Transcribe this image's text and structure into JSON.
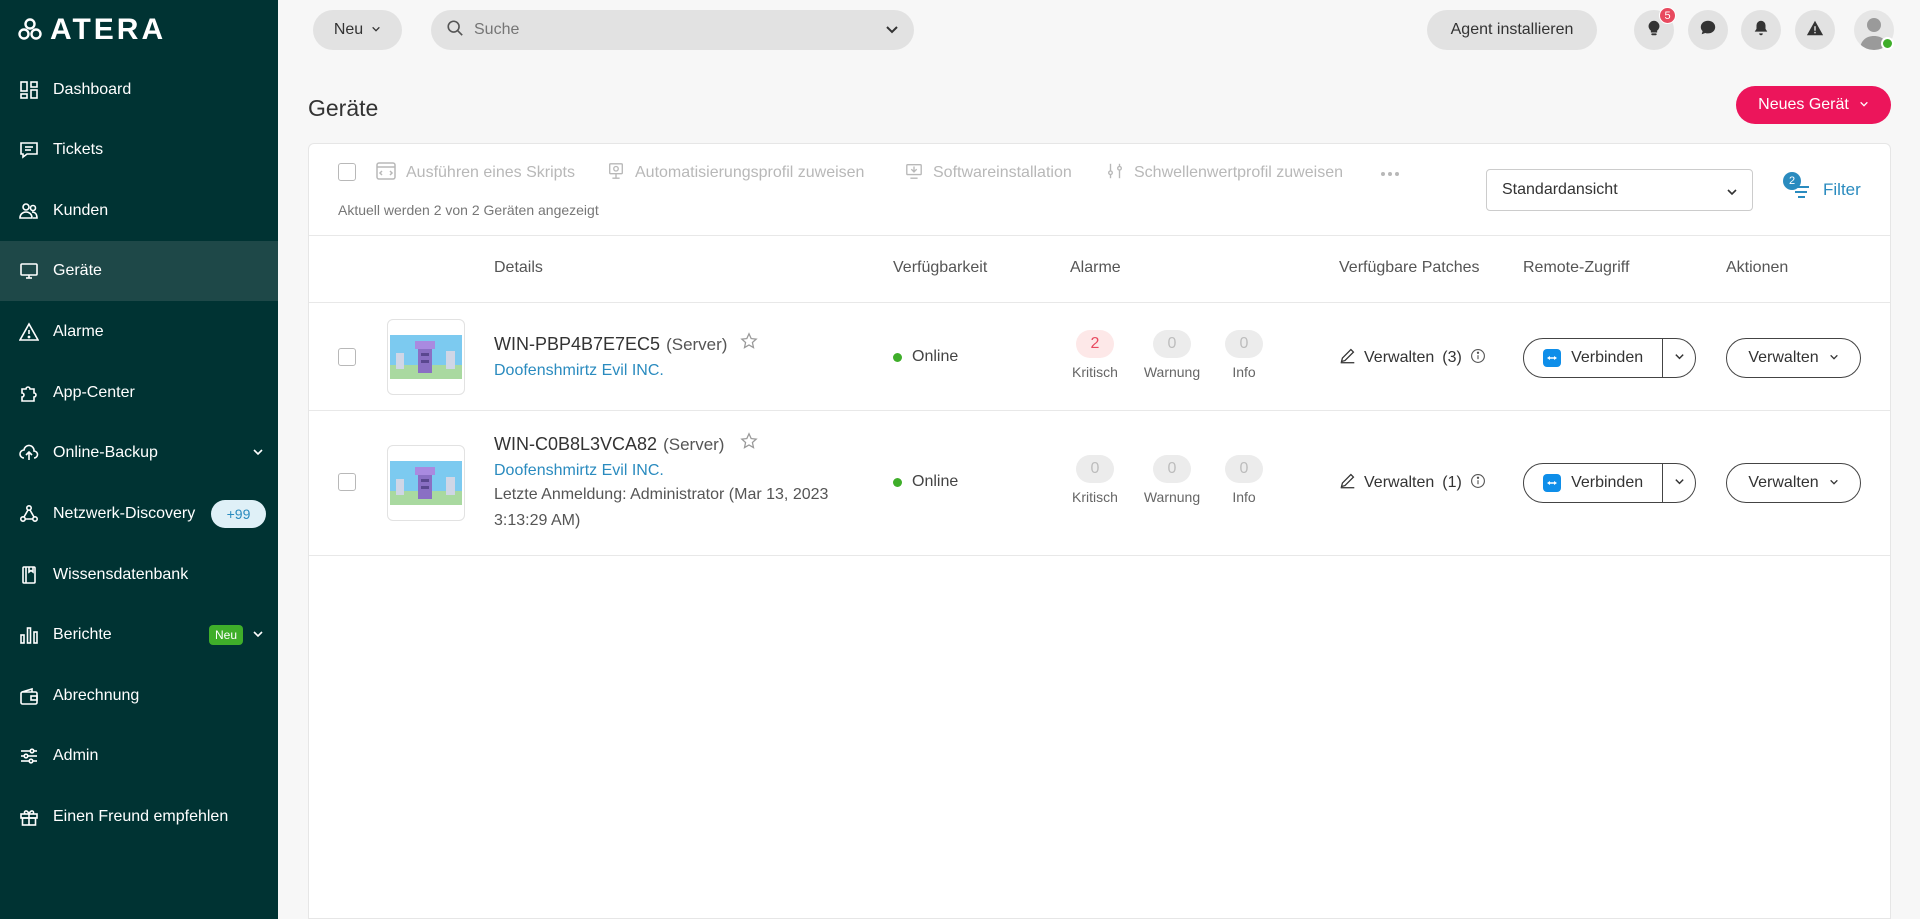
{
  "brand": {
    "logo_text": "ATERA"
  },
  "sidebar": {
    "items": [
      {
        "label": "Dashboard"
      },
      {
        "label": "Tickets"
      },
      {
        "label": "Kunden"
      },
      {
        "label": "Geräte"
      },
      {
        "label": "Alarme"
      },
      {
        "label": "App-Center"
      },
      {
        "label": "Online-Backup"
      },
      {
        "label": "Netzwerk-Discovery",
        "badge": "+99"
      },
      {
        "label": "Wissensdatenbank"
      },
      {
        "label": "Berichte",
        "badge": "Neu"
      },
      {
        "label": "Abrechnung"
      },
      {
        "label": "Admin"
      },
      {
        "label": "Einen Freund empfehlen"
      }
    ]
  },
  "topbar": {
    "new_label": "Neu",
    "search_placeholder": "Suche",
    "install_agent_label": "Agent installieren",
    "notification_count": "5"
  },
  "page": {
    "title": "Geräte",
    "new_device_label": "Neues Gerät"
  },
  "toolbar": {
    "run_script": "Ausführen eines Skripts",
    "assign_profile": "Automatisierungsprofil zuweisen",
    "software_install": "Softwareinstallation",
    "threshold_profile": "Schwellenwertprofil zuweisen",
    "status_text": "Aktuell werden 2 von 2 Geräten angezeigt",
    "view_select": "Standardansicht",
    "filter_label": "Filter",
    "filter_count": "2"
  },
  "table": {
    "headers": {
      "details": "Details",
      "availability": "Verfügbarkeit",
      "alarms": "Alarme",
      "patches": "Verfügbare Patches",
      "remote": "Remote-Zugriff",
      "actions": "Aktionen"
    },
    "rows": [
      {
        "name": "WIN-PBP4B7E7EC5",
        "type": "(Server)",
        "client": "Doofenshmirtz Evil INC.",
        "last_login": "",
        "status": "Online",
        "alarms": {
          "critical": "2",
          "warning": "0",
          "info": "0"
        },
        "alarm_labels": {
          "critical": "Kritisch",
          "warning": "Warnung",
          "info": "Info"
        },
        "patches": "Verwalten",
        "patch_count": "(3)",
        "connect": "Verbinden",
        "manage": "Verwalten"
      },
      {
        "name": "WIN-C0B8L3VCA82",
        "type": "(Server)",
        "client": "Doofenshmirtz Evil INC.",
        "last_login": "Letzte Anmeldung: Administrator (Mar 13, 2023 3:13:29 AM)",
        "status": "Online",
        "alarms": {
          "critical": "0",
          "warning": "0",
          "info": "0"
        },
        "alarm_labels": {
          "critical": "Kritisch",
          "warning": "Warnung",
          "info": "Info"
        },
        "patches": "Verwalten",
        "patch_count": "(1)",
        "connect": "Verbinden",
        "manage": "Verwalten"
      }
    ]
  },
  "colors": {
    "sidebar_bg": "#003333",
    "accent_pink": "#ec155b",
    "link_blue": "#2a8bbf",
    "online_green": "#3fae2a",
    "critical_red": "#e84a5f"
  }
}
